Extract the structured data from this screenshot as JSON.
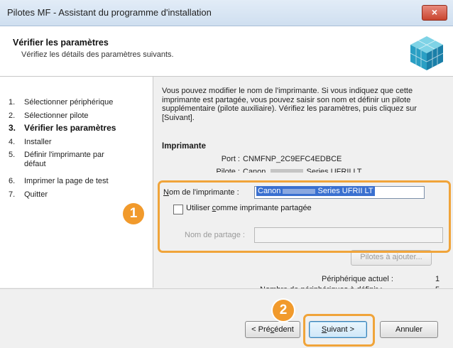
{
  "window": {
    "title": "Pilotes MF - Assistant du programme d'installation",
    "close_label": "×"
  },
  "header": {
    "title": "Vérifier les paramètres",
    "subtitle": "Vérifiez les détails des paramètres suivants."
  },
  "steps": [
    {
      "num": "1.",
      "label": "Sélectionner périphérique"
    },
    {
      "num": "2.",
      "label": "Sélectionner pilote"
    },
    {
      "num": "3.",
      "label": "Vérifier les paramètres"
    },
    {
      "num": "4.",
      "label": "Installer"
    },
    {
      "num": "5.",
      "label": "Définir l'imprimante par défaut"
    },
    {
      "num": "6.",
      "label": "Imprimer la page de test"
    },
    {
      "num": "7.",
      "label": "Quitter"
    }
  ],
  "main": {
    "description": "Vous pouvez modifier le nom de l'imprimante. Si vous indiquez que cette imprimante est partagée, vous pouvez saisir son nom et définir un pilote supplémentaire (pilote auxiliaire). Vérifiez les paramètres, puis cliquez sur [Suivant].",
    "section_title": "Imprimante",
    "port_label": "Port :",
    "port_value": "CNMFNP_2C9EFC4EDBCE",
    "driver_label": "Pilote :",
    "driver_value_prefix": "Canon",
    "driver_value_suffix": "Series UFRII LT",
    "printer_name_label_prefix": "N",
    "printer_name_label_rest": "om de l'imprimante :",
    "printer_name_prefix": "Canon",
    "printer_name_suffix": "Series UFRII LT",
    "share_label_prefix": "Utiliser ",
    "share_label_underlined": "c",
    "share_label_rest": "omme imprimante partagée",
    "share_name_label": "Nom de partage :",
    "share_name_value": "",
    "drivers_button": "Pilotes à ajouter...",
    "current_device_label": "Périphérique actuel :",
    "current_device_value": "1",
    "devices_to_define_label": "Nombre de périphériques à définir :",
    "devices_to_define_value": "5"
  },
  "badges": {
    "one": "1",
    "two": "2"
  },
  "footer": {
    "prev_prefix": "< Pré",
    "prev_underlined": "c",
    "prev_rest": "édent",
    "next_underlined": "S",
    "next_rest": "uivant >",
    "cancel": "Annuler"
  },
  "colors": {
    "highlight": "#f0a43a",
    "badge": "#f19a2c",
    "selection": "#3a70d0"
  }
}
